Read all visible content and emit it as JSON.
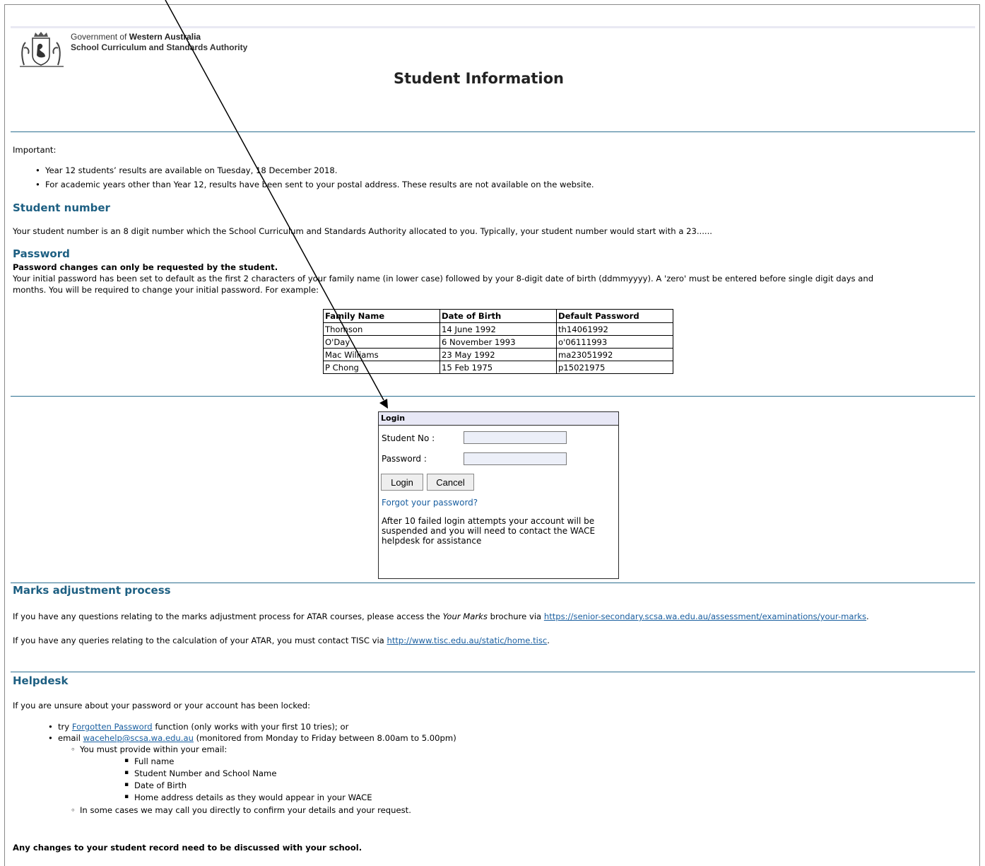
{
  "header": {
    "gov_prefix": "Government of ",
    "gov_bold": "Western Australia",
    "authority": "School Curriculum and Standards Authority",
    "page_title": "Student Information"
  },
  "important": {
    "label": "Important:",
    "items": [
      "Year 12 students’ results are available on Tuesday, 18 December 2018.",
      "For academic years other than Year 12, results have been sent to your postal address. These results are not available on the website."
    ]
  },
  "student_number": {
    "heading": "Student number",
    "text": "Your student number is an 8 digit number which the School Curriculum and Standards Authority allocated to you. Typically, your student number would start with  a 23......"
  },
  "password": {
    "heading": "Password",
    "bold_note": "Password changes can only be requested by the student.",
    "line1": "Your initial password has been set to default as the first 2 characters of your family name (in lower case) followed by your 8-digit date of birth (ddmmyyyy). A 'zero' must be entered before single digit days and",
    "line2": "months. You will be required to change your initial password. For example:",
    "table": {
      "headers": [
        "Family Name",
        "Date of Birth",
        "Default Password"
      ],
      "rows": [
        [
          "Thomson",
          "14 June 1992",
          "th14061992"
        ],
        [
          "O'Day",
          "6 November 1993",
          "o'06111993"
        ],
        [
          "Mac Williams",
          "23 May 1992",
          "ma23051992"
        ],
        [
          "P Chong",
          "15 Feb 1975",
          "p15021975"
        ]
      ]
    }
  },
  "login": {
    "title": "Login",
    "student_no_label": "Student No :",
    "student_no_value": "",
    "password_label": "Password :",
    "password_value": "",
    "login_button": "Login",
    "cancel_button": "Cancel",
    "forgot_link": "Forgot your password?",
    "note": "After 10 failed login attempts your account will be suspended and you will need to contact the WACE helpdesk for assistance"
  },
  "marks": {
    "heading": "Marks adjustment process",
    "p1_before": "If you have any questions relating to the marks adjustment process for ATAR courses, please access the ",
    "p1_italic": "Your Marks",
    "p1_middle": " brochure via ",
    "p1_link": "https://senior-secondary.scsa.wa.edu.au/assessment/examinations/your-marks",
    "p1_end": ".",
    "p2_before": "If you have any queries relating to the calculation of your ATAR, you must contact TISC via ",
    "p2_link": "http://www.tisc.edu.au/static/home.tisc",
    "p2_end": "."
  },
  "helpdesk": {
    "heading": "Helpdesk",
    "intro": "If you are unsure about your password or your account has been locked:",
    "try_before": "try ",
    "try_link": "Forgotten Password",
    "try_after": " function (only works with your first 10 tries); or",
    "email_before": "email ",
    "email_link": "wacehelp@scsa.wa.edu.au",
    "email_after": " (monitored from Monday to Friday between 8.00am to 5.00pm)",
    "provide": "You must provide within your email:",
    "provide_items": [
      "Full name",
      "Student Number and School Name",
      "Date of Birth",
      "Home address details as they would appear in your WACE"
    ],
    "call": "In some cases we may call you directly to confirm your details and your request."
  },
  "footer_note": "Any changes to your student record need to be discussed with your school.",
  "colors": {
    "heading": "#1d5f82",
    "rule": "#2c6f90",
    "link": "#1a5fa0",
    "login_header": "#e8e8f6"
  }
}
